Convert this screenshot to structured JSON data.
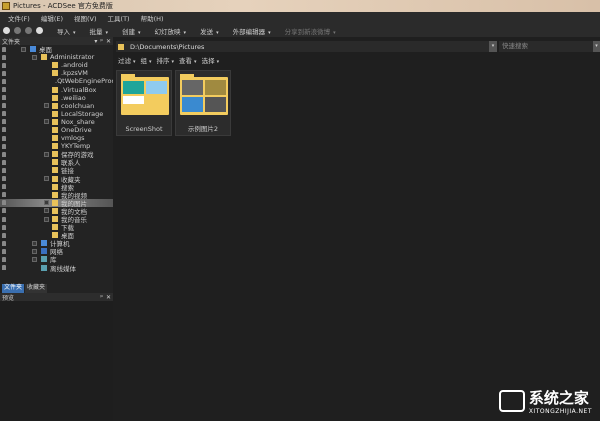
{
  "window": {
    "title": "Pictures - ACDSee 官方免费版"
  },
  "menu": [
    "文件(F)",
    "编辑(E)",
    "视图(V)",
    "工具(T)",
    "帮助(H)"
  ],
  "toolbar": [
    {
      "label": "导入"
    },
    {
      "label": "批量"
    },
    {
      "label": "创建"
    },
    {
      "label": "幻灯放映"
    },
    {
      "label": "发送"
    },
    {
      "label": "外部编辑器"
    },
    {
      "label": "分享到新浪微博",
      "disabled": true
    }
  ],
  "folders_panel": {
    "title": "文件夹",
    "controls": [
      "▾",
      "ᵖ",
      "✕"
    ]
  },
  "tree": [
    {
      "label": "桌面",
      "depth": 0,
      "icon": "desktop",
      "expander": true
    },
    {
      "label": "Administrator",
      "depth": 1,
      "icon": "user-folder",
      "expander": true
    },
    {
      "label": ".android",
      "depth": 2
    },
    {
      "label": ".kpzsVM",
      "depth": 2
    },
    {
      "label": ".QtWebEngineProcess",
      "depth": 2
    },
    {
      "label": ".VirtualBox",
      "depth": 2
    },
    {
      "label": ".weiliao",
      "depth": 2
    },
    {
      "label": "coolchuan",
      "depth": 2,
      "expander": true
    },
    {
      "label": "LocalStorage",
      "depth": 2
    },
    {
      "label": "Nox_share",
      "depth": 2,
      "expander": true
    },
    {
      "label": "OneDrive",
      "depth": 2
    },
    {
      "label": "vmlogs",
      "depth": 2
    },
    {
      "label": "YKYTemp",
      "depth": 2
    },
    {
      "label": "保存的游戏",
      "depth": 2,
      "expander": true
    },
    {
      "label": "联系人",
      "depth": 2
    },
    {
      "label": "链接",
      "depth": 2
    },
    {
      "label": "收藏夹",
      "depth": 2,
      "expander": true
    },
    {
      "label": "搜索",
      "depth": 2
    },
    {
      "label": "我的视频",
      "depth": 2
    },
    {
      "label": "我的图片",
      "depth": 2,
      "expander": true,
      "selected": true
    },
    {
      "label": "我的文档",
      "depth": 2,
      "expander": true
    },
    {
      "label": "我的音乐",
      "depth": 2,
      "expander": true
    },
    {
      "label": "下载",
      "depth": 2
    },
    {
      "label": "桌面",
      "depth": 2
    },
    {
      "label": "计算机",
      "depth": 1,
      "icon": "computer",
      "expander": true
    },
    {
      "label": "网络",
      "depth": 1,
      "icon": "network",
      "expander": true
    },
    {
      "label": "库",
      "depth": 1,
      "icon": "library",
      "expander": true
    },
    {
      "label": "离线媒体",
      "depth": 1,
      "icon": "offline"
    }
  ],
  "panel_tabs": [
    {
      "label": "文件夹",
      "active": true
    },
    {
      "label": "收藏夹"
    }
  ],
  "preview_panel": {
    "title": "预览",
    "controls": [
      "ᵖ",
      "✕"
    ]
  },
  "address": {
    "path": "D:\\Documents\\Pictures"
  },
  "search": {
    "placeholder": "快速搜索"
  },
  "subtoolbar": [
    "过滤",
    "组",
    "排序",
    "查看",
    "选择"
  ],
  "items": [
    {
      "name": "ScreenShot"
    },
    {
      "name": "示例图片2"
    }
  ],
  "watermark": {
    "title": "系统之家",
    "url": "XITONGZHIJIA.NET"
  }
}
